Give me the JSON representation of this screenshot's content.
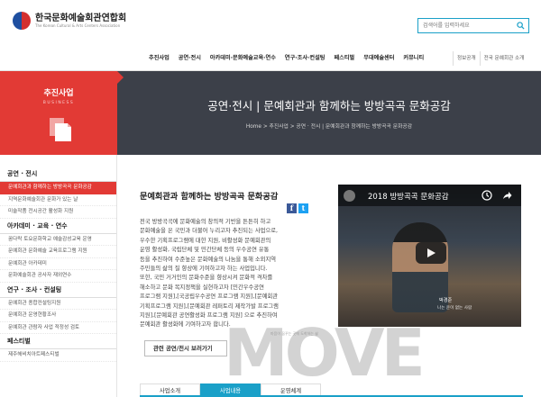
{
  "header": {
    "org_name": "한국문화예술회관연합회",
    "org_name_en": "The Korean Cultural & Arts Centers Association",
    "search_placeholder": "검색어를 입력하세요"
  },
  "nav": {
    "items": [
      "추진사업",
      "공연·전시",
      "아카데미·문화예술교육·연수",
      "연구·조사·컨설팅",
      "페스티벌",
      "무대예술센터",
      "커뮤니티"
    ],
    "right_items": [
      "정보공개",
      "전국 문예회관 소개"
    ]
  },
  "category": {
    "title": "추진사업",
    "subtitle": "BUSINESS"
  },
  "banner": {
    "title": "공연·전시 | 문예회관과 함께하는 방방곡곡 문화공감",
    "breadcrumb": "Home  >  추진사업  >  공연 · 전시 | 문예회관과 함께하는 방방곡곡 문화공감"
  },
  "sidebar": {
    "sections": [
      {
        "title": "공연 · 전시",
        "items": [
          "문예회관과 함께하는 방방곡곡 문화공감",
          "지역문화예술회관 문화가 있는 날",
          "미술작품 전시공간 활성화 지원"
        ]
      },
      {
        "title": "아카데미 · 교육 · 연수",
        "items": [
          "꿈다락 토요문화학교 예술감성교육 운영",
          "문예회관 문화예술 교육프로그램 지원",
          "문예회관 아카데미",
          "문화예술회관 공사자 재외연수"
        ]
      },
      {
        "title": "연구 · 조사 · 컨설팅",
        "items": [
          "문예회관 종합컨설팅지원",
          "문예회관 운영현황조사",
          "문예회관 관람자 사업 적정성 검토"
        ]
      },
      {
        "title": "페스티벌",
        "items": [
          "제주해비치아트페스티벌"
        ]
      }
    ]
  },
  "content": {
    "title": "문예회관과 함께하는 방방곡곡 문화공감",
    "lines": [
      "전국 방방곡곡에 문화예술의 창의적 기반을 튼튼히 하고",
      "문화예술을 온 국민과 더불어 누리고자 추진되는 사업으로,",
      "우수한 기획프로그램에 대한 지원, 비활성화 문예회관의",
      "운영 활성화, 국립단체 및 민간단체 등의 우수공연 유통",
      "등을 추진하여 수준높은 문화예술의 나눔을 통해 소외지역",
      "주민들의 삶의 질 향상에 기여하고자 하는 사업입니다.",
      "또한, 국민 거거인의 문화수준을 향상시켜 문화적 격차를",
      "해소하고 문화 복지정책을 실현하고자 [민간우수공연",
      "프로그램 지원],[국공립우수공연 프로그램 지원],[문예회관",
      "기획프로그램 지원],[문예회관 레퍼토리 제작가발 프로그램",
      "지원],[문예회관 공연활성화 프로그램 지원] 으로 추진하여",
      "문예회관 활성화에 기여하고자 합니다."
    ],
    "more_button": "관련 공연/전시 보러가기",
    "facebook_label": "f",
    "twitter_label": "t"
  },
  "video": {
    "title": "2018 방방곡곡 문화공감",
    "caption_name": "박경준",
    "caption_line": "나는 운이 없는 사람"
  },
  "tabs": [
    {
      "label": "사업소개",
      "active": false
    },
    {
      "label": "사업내용",
      "active": true
    },
    {
      "label": "운영체계",
      "active": false
    }
  ],
  "watermark": {
    "text": "MOVE",
    "sub": "마음이 꿈꾸는 곳에 도착하는 삶"
  },
  "colors": {
    "accent_red": "#e23a35",
    "accent_blue": "#1aa0c8",
    "banner_dark": "#3c4049"
  }
}
